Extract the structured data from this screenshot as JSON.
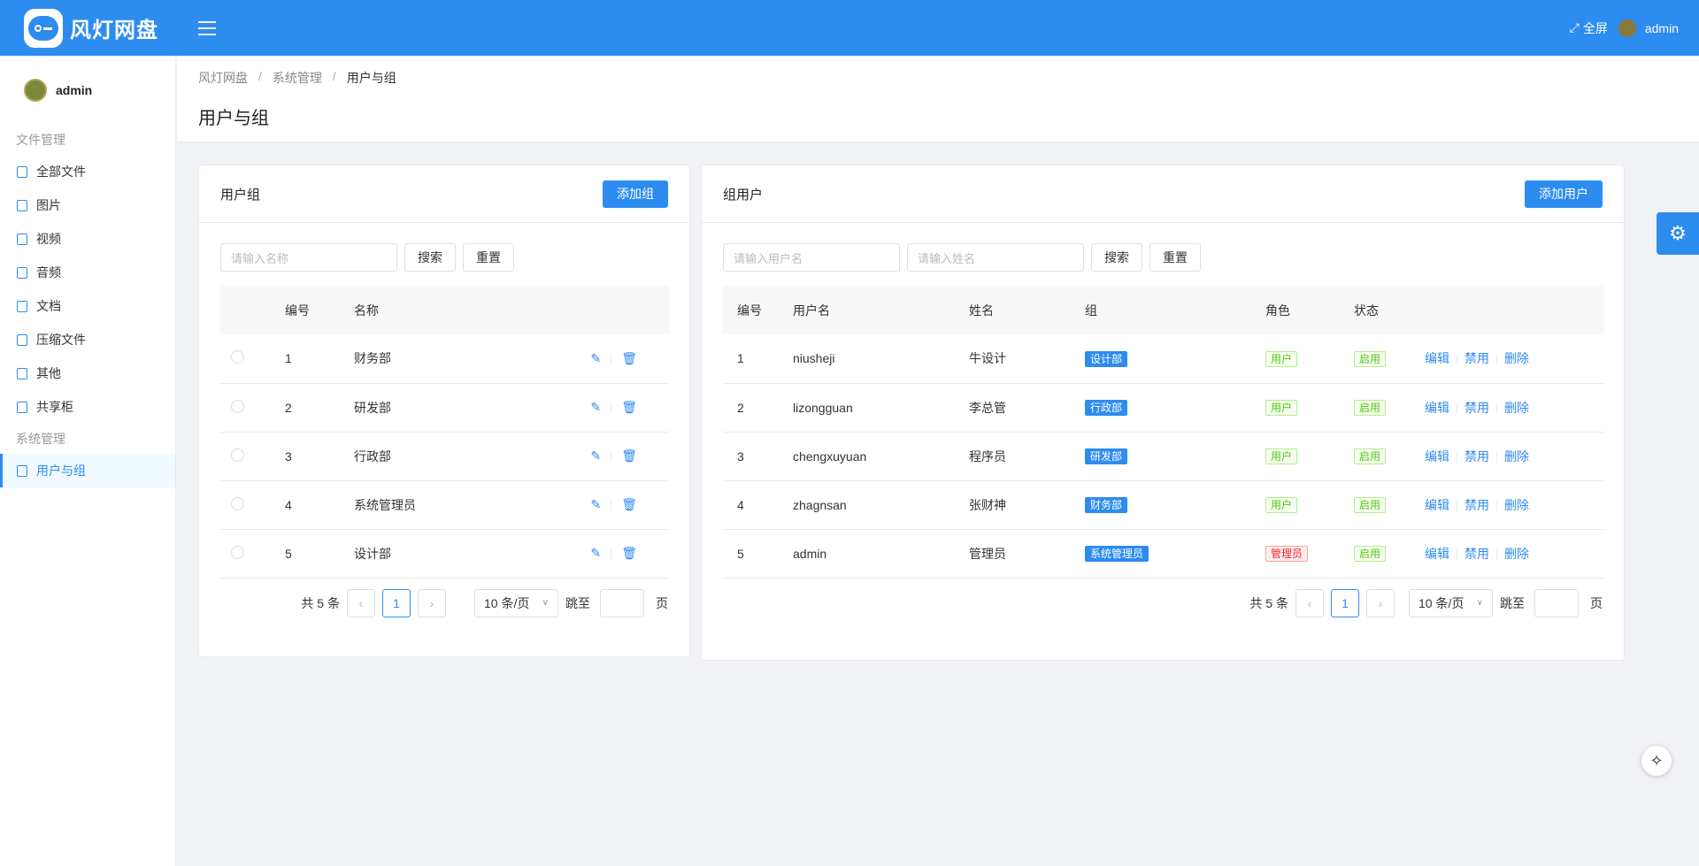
{
  "header": {
    "app_title": "风灯网盘",
    "fullscreen_label": "全屏",
    "user_name": "admin"
  },
  "sidebar": {
    "user_name": "admin",
    "groups": [
      {
        "label": "文件管理",
        "items": [
          {
            "label": "全部文件",
            "icon": "files-icon"
          },
          {
            "label": "图片",
            "icon": "image-file-icon"
          },
          {
            "label": "视频",
            "icon": "video-icon"
          },
          {
            "label": "音频",
            "icon": "audio-icon"
          },
          {
            "label": "文档",
            "icon": "document-icon"
          },
          {
            "label": "压缩文件",
            "icon": "archive-file-icon"
          },
          {
            "label": "其他",
            "icon": "other-file-icon"
          },
          {
            "label": "共享柜",
            "icon": "share-cabinet-icon"
          }
        ]
      },
      {
        "label": "系统管理",
        "items": [
          {
            "label": "用户与组",
            "icon": "users-groups-icon",
            "active": true
          }
        ]
      }
    ]
  },
  "breadcrumb": [
    "风灯网盘",
    "系统管理",
    "用户与组"
  ],
  "page_title": "用户与组",
  "group_panel": {
    "title": "用户组",
    "add_button": "添加组",
    "search_placeholder": "请输入名称",
    "search_button": "搜索",
    "reset_button": "重置",
    "columns": [
      "编号",
      "名称"
    ],
    "rows": [
      {
        "id": "1",
        "name": "财务部"
      },
      {
        "id": "2",
        "name": "研发部"
      },
      {
        "id": "3",
        "name": "行政部"
      },
      {
        "id": "4",
        "name": "系统管理员"
      },
      {
        "id": "5",
        "name": "设计部"
      }
    ],
    "pager": {
      "total": "共 5 条",
      "current": "1",
      "page_size": "10 条/页",
      "jump_label": "跳至",
      "page_suffix": "页"
    }
  },
  "user_panel": {
    "title": "组用户",
    "add_button": "添加用户",
    "username_placeholder": "请输入用户名",
    "name_placeholder": "请输入姓名",
    "search_button": "搜索",
    "reset_button": "重置",
    "columns": [
      "编号",
      "用户名",
      "姓名",
      "组",
      "角色",
      "状态"
    ],
    "rows": [
      {
        "id": "1",
        "username": "niusheji",
        "name": "牛设计",
        "group": "设计部",
        "role": "用户",
        "role_type": "user",
        "status": "启用"
      },
      {
        "id": "2",
        "username": "lizongguan",
        "name": "李总管",
        "group": "行政部",
        "role": "用户",
        "role_type": "user",
        "status": "启用"
      },
      {
        "id": "3",
        "username": "chengxuyuan",
        "name": "程序员",
        "group": "研发部",
        "role": "用户",
        "role_type": "user",
        "status": "启用"
      },
      {
        "id": "4",
        "username": "zhagnsan",
        "name": "张财神",
        "group": "财务部",
        "role": "用户",
        "role_type": "user",
        "status": "启用"
      },
      {
        "id": "5",
        "username": "admin",
        "name": "管理员",
        "group": "系统管理员",
        "role": "管理员",
        "role_type": "admin",
        "status": "启用"
      }
    ],
    "actions": {
      "edit": "编辑",
      "disable": "禁用",
      "delete": "删除"
    },
    "pager": {
      "total": "共 5 条",
      "current": "1",
      "page_size": "10 条/页",
      "jump_label": "跳至",
      "page_suffix": "页"
    }
  },
  "colors": {
    "primary": "#2d8cf0",
    "success": "#52c41a",
    "danger": "#f5222d"
  }
}
